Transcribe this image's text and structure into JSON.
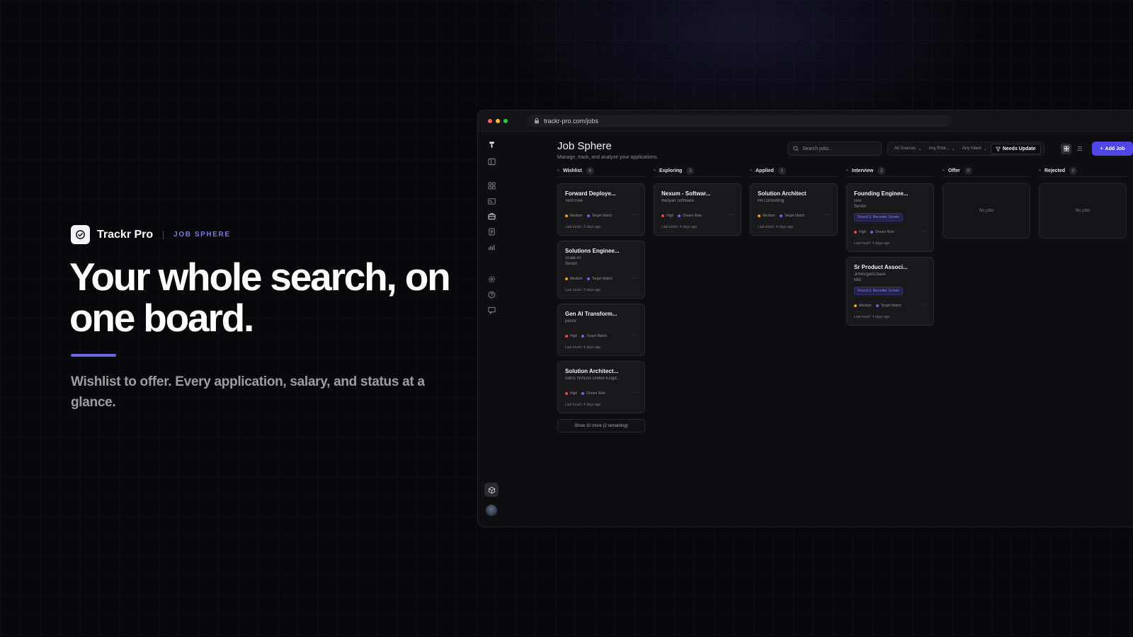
{
  "hero": {
    "brand_name": "Trackr Pro",
    "brand_tag": "JOB SPHERE",
    "headline_line1": "Your whole search, on",
    "headline_line2": "one board.",
    "subhead": "Wishlist to offer. Every application, salary, and status at a glance."
  },
  "browser": {
    "url": "trackr-pro.com/jobs"
  },
  "app": {
    "title": "Job Sphere",
    "subtitle": "Manage, track, and analyze your applications.",
    "search_placeholder": "Search jobs...",
    "filters": [
      "All Sources",
      "Any Prior...",
      "Any Intent"
    ],
    "active_filter": "Needs Update",
    "add_button": "Add Job",
    "show_more": "Show 10 more (2 remaining)",
    "empty_text": "No jobs"
  },
  "colors": {
    "accent": "#4e46e5",
    "priority_high": "#ef4444",
    "priority_medium": "#f59e0b",
    "intent_dot": "#6d64e8"
  },
  "sidebar_icons": [
    "logo-icon",
    "panel-icon",
    "grid-icon",
    "card-icon",
    "briefcase-icon",
    "document-icon",
    "chart-icon",
    "settings-icon",
    "help-icon",
    "chat-icon",
    "box-icon",
    "avatar"
  ],
  "columns": [
    {
      "name": "Wishlist",
      "count": "6",
      "cards": [
        {
          "title": "Forward Deploye...",
          "company": "TechTree",
          "level": "",
          "badge": "",
          "priority": "Medium",
          "intent": "Target Match",
          "last": "Last touch: 3 days ago"
        },
        {
          "title": "Solutions Enginee...",
          "company": "Scale AI",
          "level": "Senior",
          "badge": "",
          "priority": "Medium",
          "intent": "Target Match",
          "last": "Last touch: 3 days ago"
        },
        {
          "title": "Gen AI Transform...",
          "company": "pencil",
          "level": "",
          "badge": "",
          "priority": "High",
          "intent": "Target Match",
          "last": "Last touch: 4 days ago"
        },
        {
          "title": "Solution Architect...",
          "company": "GB01 NVIDIA United Kingd...",
          "level": "",
          "badge": "",
          "priority": "High",
          "intent": "Dream Role",
          "last": "Last touch: 4 days ago"
        }
      ]
    },
    {
      "name": "Exploring",
      "count": "1",
      "cards": [
        {
          "title": "Nexum - Softwar...",
          "company": "Banyan Software",
          "level": "",
          "badge": "",
          "priority": "High",
          "intent": "Dream Role",
          "last": "Last touch: 4 days ago"
        }
      ]
    },
    {
      "name": "Applied",
      "count": "1",
      "cards": [
        {
          "title": "Solution Architect",
          "company": "PA Consulting",
          "level": "",
          "badge": "",
          "priority": "Medium",
          "intent": "Target Match",
          "last": "Last touch: 4 days ago"
        }
      ]
    },
    {
      "name": "Interview",
      "count": "2",
      "cards": [
        {
          "title": "Founding Enginee...",
          "company": "Dex",
          "level": "Senior",
          "badge": "Round 1: Recruiter Screen",
          "priority": "High",
          "intent": "Dream Role",
          "last": "Last touch: 4 days ago"
        },
        {
          "title": "Sr Product Associ...",
          "company": "JPMorganChase",
          "level": "Mid",
          "badge": "Round 1: Recruiter Screen",
          "priority": "Medium",
          "intent": "Target Match",
          "last": "Last touch: 4 days ago"
        }
      ]
    },
    {
      "name": "Offer",
      "count": "0",
      "cards": []
    },
    {
      "name": "Rejected",
      "count": "0",
      "cards": []
    }
  ]
}
